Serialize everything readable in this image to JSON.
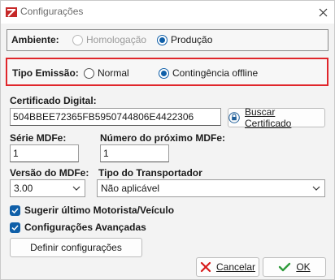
{
  "window": {
    "title": "Configurações"
  },
  "ambiente": {
    "label": "Ambiente:",
    "options": [
      {
        "label": "Homologação",
        "checked": false,
        "disabled": true
      },
      {
        "label": "Produção",
        "checked": true,
        "disabled": false
      }
    ]
  },
  "emissao": {
    "label": "Tipo Emissão:",
    "options": [
      {
        "label": "Normal",
        "checked": false
      },
      {
        "label": "Contingência offline",
        "checked": true
      }
    ]
  },
  "certificado": {
    "label": "Certificado Digital:",
    "value": "504BBEE72365FB5950744806E4422306",
    "button_label": "Buscar Certificado"
  },
  "serie": {
    "label": "Série MDFe:",
    "value": "1"
  },
  "proximo": {
    "label": "Número do próximo MDFe:",
    "value": "1"
  },
  "versao": {
    "label": "Versão do MDFe:",
    "value": "3.00"
  },
  "transportador": {
    "label": "Tipo do Transportador",
    "value": "Não aplicável"
  },
  "checks": {
    "sugerir": {
      "label": "Sugerir último Motorista/Veículo",
      "checked": true
    },
    "avancadas": {
      "label": "Configurações Avançadas",
      "checked": true
    }
  },
  "definir_button": "Definir configurações",
  "footer": {
    "cancel_label": "Cancelar",
    "ok_label": "OK"
  },
  "colors": {
    "accent": "#0f5fa8",
    "highlight_border": "#e0262b",
    "cancel_icon": "#d81b1b",
    "ok_icon": "#2e9b3a"
  }
}
